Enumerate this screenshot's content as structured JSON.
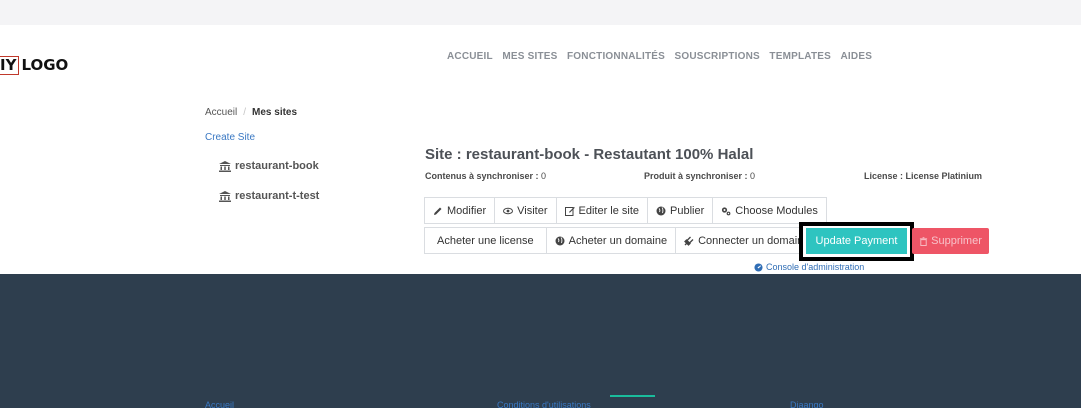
{
  "logo": {
    "boxed": "IY",
    "text": "LOGO"
  },
  "nav": [
    "ACCUEIL",
    "MES SITES",
    "FONCTIONNALITÉS",
    "SOUSCRIPTIONS",
    "TEMPLATES",
    "AIDES"
  ],
  "breadcrumb": {
    "home": "Accueil",
    "separator": "/",
    "current": "Mes sites"
  },
  "create_site": "Create Site",
  "sites": [
    {
      "name": "restaurant-book",
      "icon": "bank-icon"
    },
    {
      "name": "restaurant-t-test",
      "icon": "bank-icon"
    }
  ],
  "site": {
    "title": "Site : restaurant-book - Restautant 100% Halal",
    "contenus_label": "Contenus à synchroniser :",
    "contenus_value": "0",
    "produit_label": "Produit à synchroniser :",
    "produit_value": "0",
    "license_label": "License :",
    "license_value": "License Platinium"
  },
  "actions_row1": [
    {
      "label": "Modifier",
      "icon": "pencil-icon"
    },
    {
      "label": "Visiter",
      "icon": "eye-icon"
    },
    {
      "label": "Editer le site",
      "icon": "edit-icon"
    },
    {
      "label": "Publier",
      "icon": "globe-icon"
    },
    {
      "label": "Choose Modules",
      "icon": "cogs-icon"
    }
  ],
  "actions_row2": [
    {
      "label": "Acheter une license",
      "icon": ""
    },
    {
      "label": "Acheter un domaine",
      "icon": "globe-icon"
    },
    {
      "label": "Connecter un domaine",
      "icon": "plug-icon"
    }
  ],
  "update_payment": "Update Payment",
  "delete_label": "Supprimer",
  "console": "Console d'administration",
  "footer": {
    "accueil": "Accueil",
    "conditions": "Conditions d'utilisations",
    "brand": "Diaango"
  },
  "colors": {
    "accent": "#2ec4c0",
    "danger": "#ee5566",
    "footer_bg": "#2e3e4e",
    "link": "#3a78c3"
  }
}
